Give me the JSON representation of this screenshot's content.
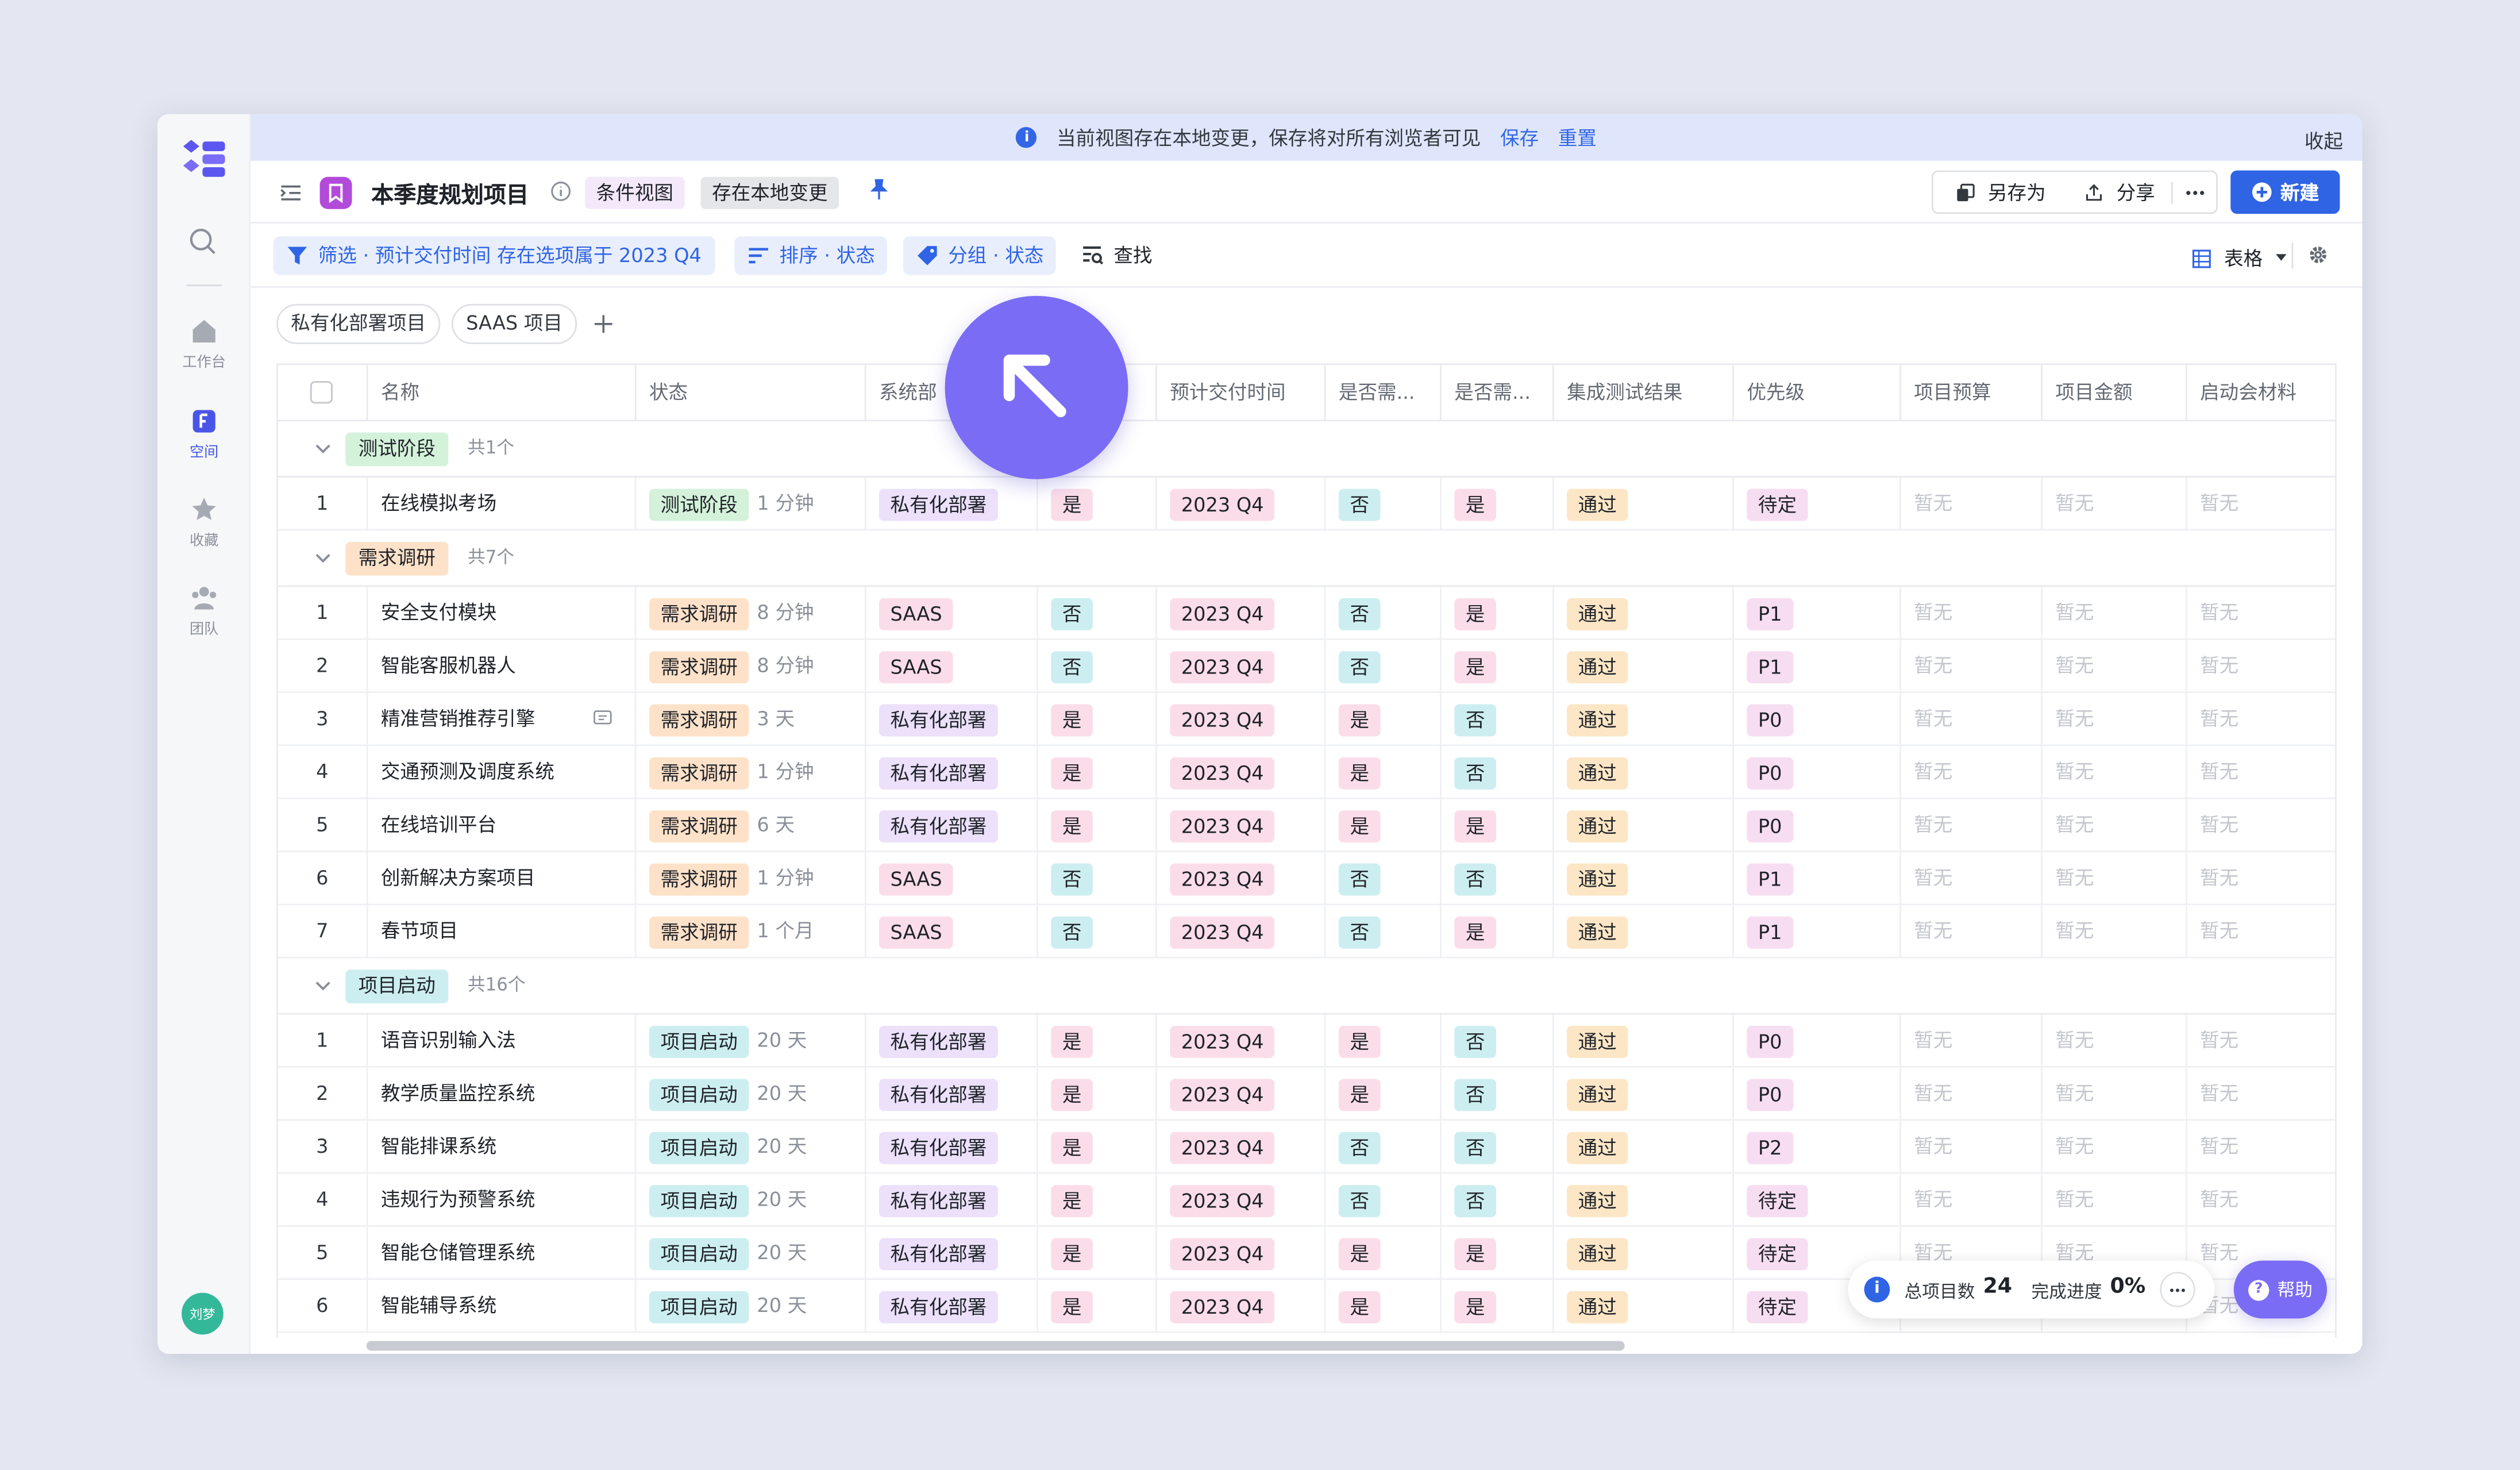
{
  "banner": {
    "message": "当前视图存在本地变更，保存将对所有浏览者可见",
    "save": "保存",
    "reset": "重置",
    "collapse": "收起"
  },
  "nav": {
    "items": [
      {
        "label": "工作台",
        "icon": "home-icon"
      },
      {
        "label": "空间",
        "icon": "space-icon"
      },
      {
        "label": "收藏",
        "icon": "star-icon"
      },
      {
        "label": "团队",
        "icon": "team-icon"
      }
    ],
    "avatar": "刘梦"
  },
  "titlebar": {
    "title": "本季度规划项目",
    "tag_view": "条件视图",
    "tag_local": "存在本地变更",
    "save_as": "另存为",
    "share": "分享",
    "new": "新建"
  },
  "toolbar": {
    "filter": "筛选 · 预计交付时间 存在选项属于 2023 Q4",
    "sort": "排序 · 状态",
    "group": "分组 · 状态",
    "find": "查找",
    "view": "表格"
  },
  "chips": [
    "私有化部署项目",
    "SAAS 项目"
  ],
  "columns": [
    "名称",
    "状态",
    "系统部",
    "",
    "预计交付时间",
    "是否需...",
    "是否需...",
    "集成测试结果",
    "优先级",
    "项目预算",
    "项目金额",
    "启动会材料"
  ],
  "groups": [
    {
      "name": "测试阶段",
      "count": "共1个",
      "color": "t-green",
      "rows": [
        {
          "n": "1",
          "name": "在线模拟考场",
          "status": "测试阶段",
          "ago": "1 分钟",
          "dept": "私有化部署",
          "c4": "是",
          "due": "2023 Q4",
          "r1": "否",
          "r2": "是",
          "test": "通过",
          "prio": "待定"
        }
      ]
    },
    {
      "name": "需求调研",
      "count": "共7个",
      "color": "t-orange",
      "rows": [
        {
          "n": "1",
          "name": "安全支付模块",
          "status": "需求调研",
          "ago": "8 分钟",
          "dept": "SAAS",
          "c4": "否",
          "due": "2023 Q4",
          "r1": "否",
          "r2": "是",
          "test": "通过",
          "prio": "P1"
        },
        {
          "n": "2",
          "name": "智能客服机器人",
          "status": "需求调研",
          "ago": "8 分钟",
          "dept": "SAAS",
          "c4": "否",
          "due": "2023 Q4",
          "r1": "否",
          "r2": "是",
          "test": "通过",
          "prio": "P1"
        },
        {
          "n": "3",
          "name": "精准营销推荐引擎",
          "status": "需求调研",
          "ago": "3 天",
          "dept": "私有化部署",
          "c4": "是",
          "due": "2023 Q4",
          "r1": "是",
          "r2": "否",
          "test": "通过",
          "prio": "P0",
          "comment": true
        },
        {
          "n": "4",
          "name": "交通预测及调度系统",
          "status": "需求调研",
          "ago": "1 分钟",
          "dept": "私有化部署",
          "c4": "是",
          "due": "2023 Q4",
          "r1": "是",
          "r2": "否",
          "test": "通过",
          "prio": "P0"
        },
        {
          "n": "5",
          "name": "在线培训平台",
          "status": "需求调研",
          "ago": "6 天",
          "dept": "私有化部署",
          "c4": "是",
          "due": "2023 Q4",
          "r1": "是",
          "r2": "是",
          "test": "通过",
          "prio": "P0"
        },
        {
          "n": "6",
          "name": "创新解决方案项目",
          "status": "需求调研",
          "ago": "1 分钟",
          "dept": "SAAS",
          "c4": "否",
          "due": "2023 Q4",
          "r1": "否",
          "r2": "否",
          "test": "通过",
          "prio": "P1"
        },
        {
          "n": "7",
          "name": "春节项目",
          "status": "需求调研",
          "ago": "1 个月",
          "dept": "SAAS",
          "c4": "否",
          "due": "2023 Q4",
          "r1": "否",
          "r2": "是",
          "test": "通过",
          "prio": "P1"
        }
      ]
    },
    {
      "name": "项目启动",
      "count": "共16个",
      "color": "t-teal",
      "rows": [
        {
          "n": "1",
          "name": "语音识别输入法",
          "status": "项目启动",
          "ago": "20 天",
          "dept": "私有化部署",
          "c4": "是",
          "due": "2023 Q4",
          "r1": "是",
          "r2": "否",
          "test": "通过",
          "prio": "P0"
        },
        {
          "n": "2",
          "name": "教学质量监控系统",
          "status": "项目启动",
          "ago": "20 天",
          "dept": "私有化部署",
          "c4": "是",
          "due": "2023 Q4",
          "r1": "是",
          "r2": "否",
          "test": "通过",
          "prio": "P0"
        },
        {
          "n": "3",
          "name": "智能排课系统",
          "status": "项目启动",
          "ago": "20 天",
          "dept": "私有化部署",
          "c4": "是",
          "due": "2023 Q4",
          "r1": "否",
          "r2": "否",
          "test": "通过",
          "prio": "P2"
        },
        {
          "n": "4",
          "name": "违规行为预警系统",
          "status": "项目启动",
          "ago": "20 天",
          "dept": "私有化部署",
          "c4": "是",
          "due": "2023 Q4",
          "r1": "否",
          "r2": "否",
          "test": "通过",
          "prio": "待定"
        },
        {
          "n": "5",
          "name": "智能仓储管理系统",
          "status": "项目启动",
          "ago": "20 天",
          "dept": "私有化部署",
          "c4": "是",
          "due": "2023 Q4",
          "r1": "是",
          "r2": "是",
          "test": "通过",
          "prio": "待定"
        },
        {
          "n": "6",
          "name": "智能辅导系统",
          "status": "项目启动",
          "ago": "20 天",
          "dept": "私有化部署",
          "c4": "是",
          "due": "2023 Q4",
          "r1": "是",
          "r2": "是",
          "test": "通过",
          "prio": "待定"
        }
      ]
    }
  ],
  "empty_value": "暂无",
  "stats": {
    "total_label": "总项目数",
    "total": "24",
    "progress_label": "完成进度",
    "progress": "0%"
  },
  "help": "帮助",
  "colors": {
    "accent": "#2f64e4",
    "cursor": "#7a6cf5",
    "yes": "#fbdde9",
    "no": "#cdeef0"
  }
}
